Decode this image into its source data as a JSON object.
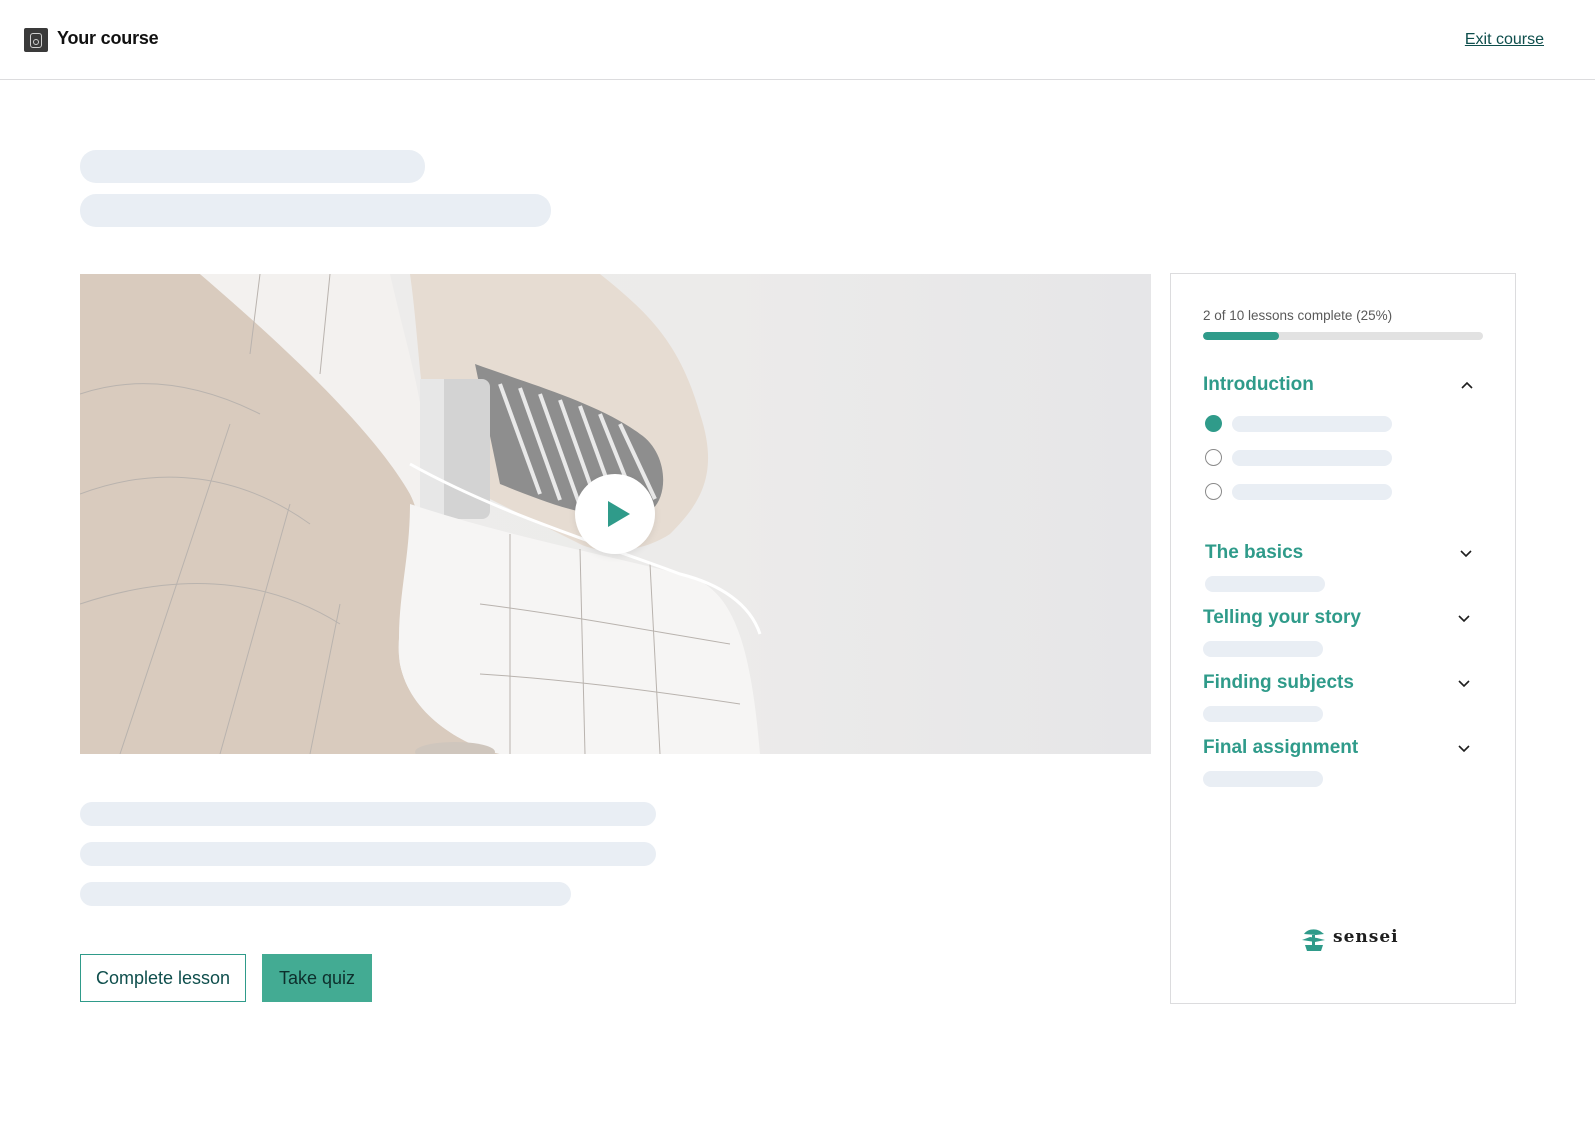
{
  "header": {
    "title": "Your course",
    "exit_label": "Exit course",
    "logo_icon": "camera-icon"
  },
  "video": {
    "play_icon": "play-icon"
  },
  "actions": {
    "complete_label": "Complete lesson",
    "quiz_label": "Take quiz"
  },
  "sidebar": {
    "progress_text": "2 of 10 lessons complete (25%)",
    "progress_fraction": 0.27,
    "modules": [
      {
        "title": "Introduction",
        "expanded": true
      },
      {
        "title": "The basics",
        "expanded": false
      },
      {
        "title": "Telling your story",
        "expanded": false
      },
      {
        "title": "Finding subjects",
        "expanded": false
      },
      {
        "title": "Final assignment",
        "expanded": false
      }
    ],
    "intro_lessons": [
      {
        "status": "current"
      },
      {
        "status": "incomplete"
      },
      {
        "status": "incomplete"
      }
    ],
    "brand": "sensei"
  },
  "colors": {
    "accent": "#2f9b8a",
    "button_fill": "#43ab93",
    "link": "#0e4e4c",
    "skeleton": "#e9eef4"
  }
}
